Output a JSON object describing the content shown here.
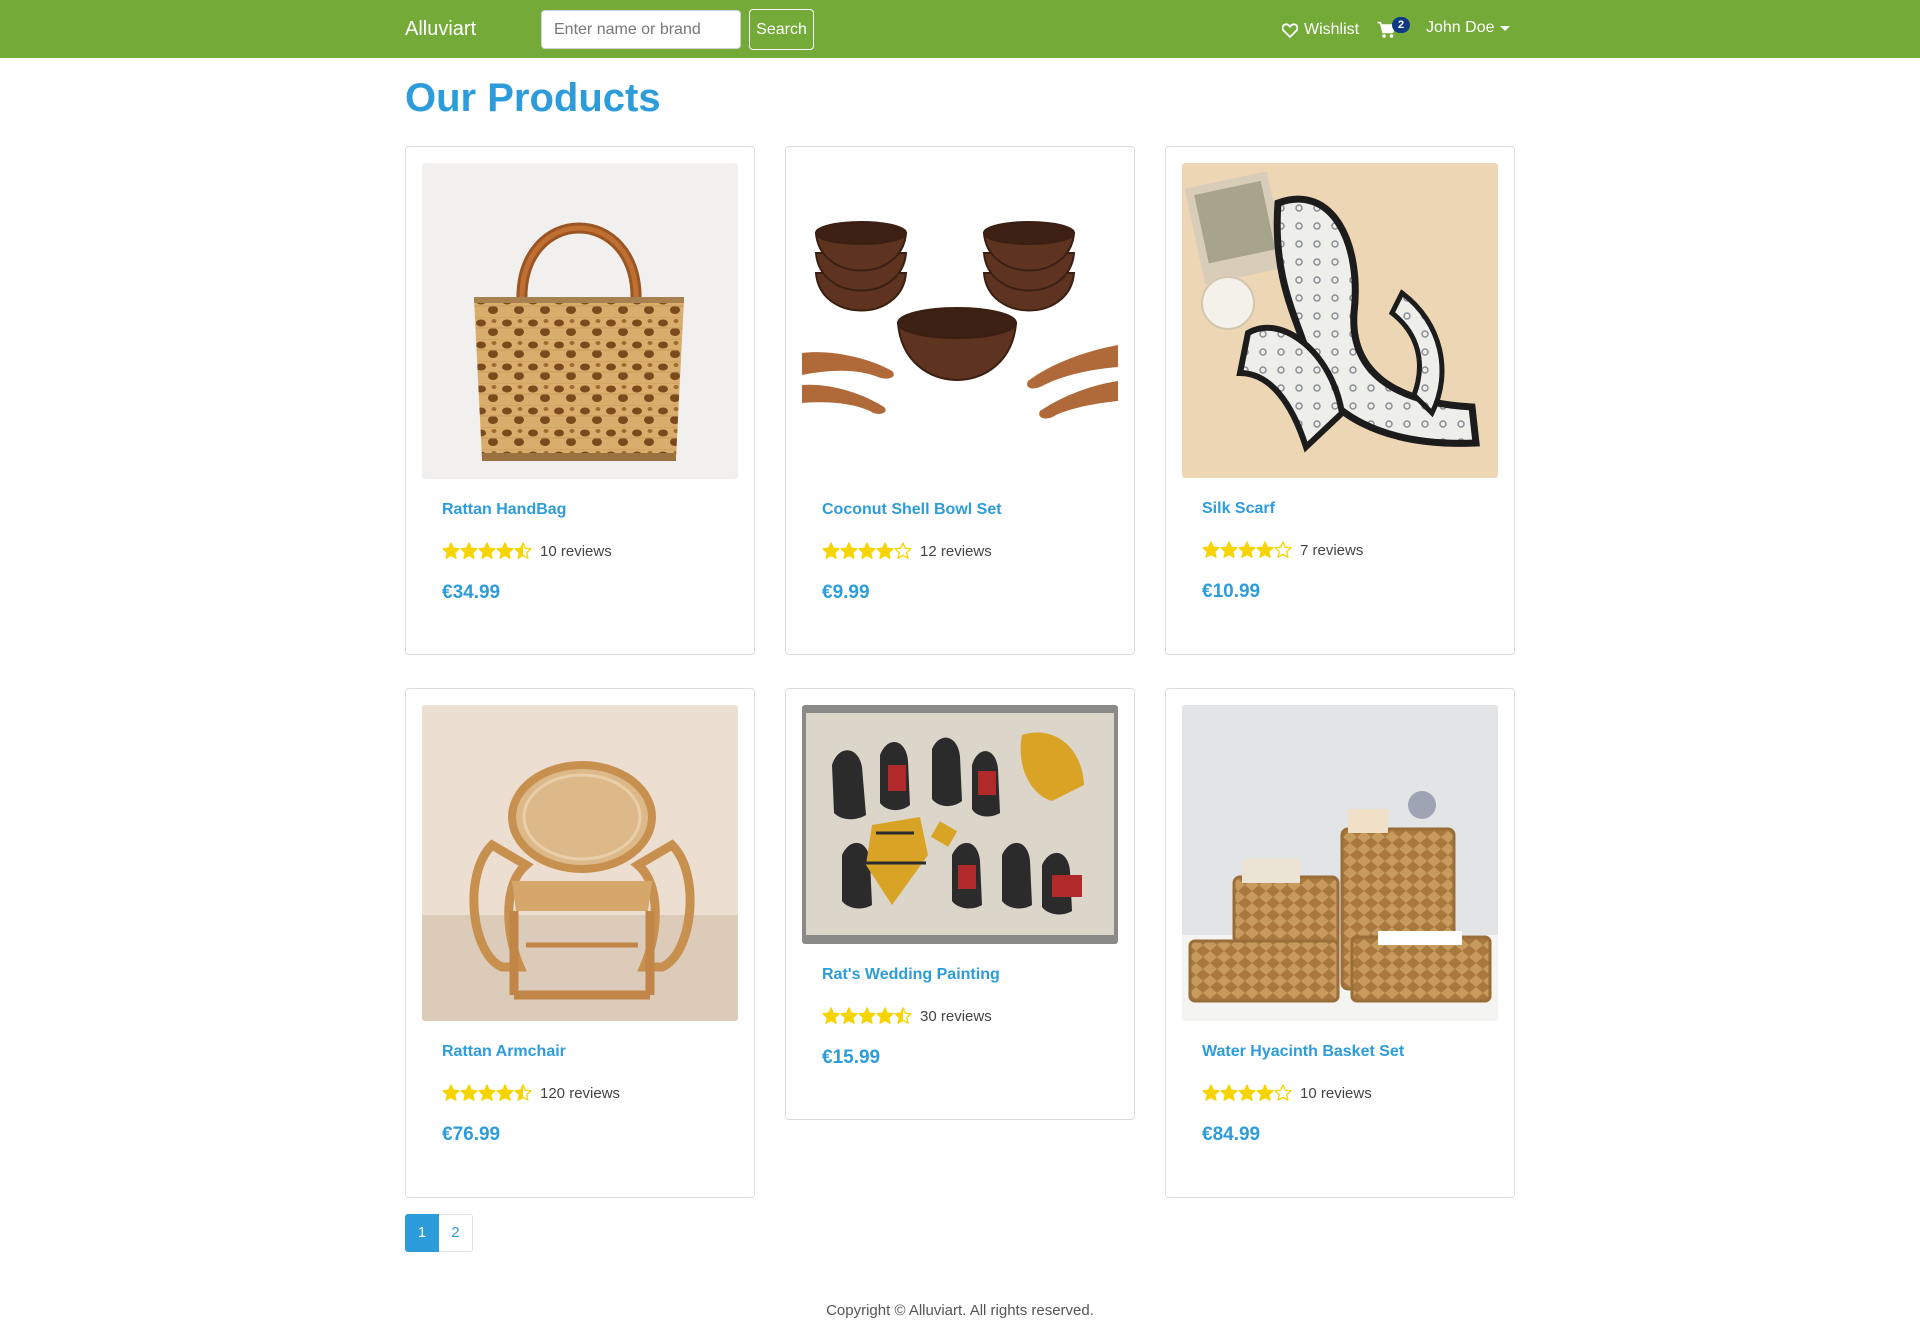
{
  "navbar": {
    "brand": "Alluviart",
    "search_placeholder": "Enter name or brand",
    "search_button": "Search",
    "wishlist_label": "Wishlist",
    "cart_count": "2",
    "user_name": "John Doe",
    "background_color": "#73aa38"
  },
  "page": {
    "title": "Our Products"
  },
  "products": [
    {
      "name": "Rattan HandBag",
      "rating": 4.5,
      "reviews": "10 reviews",
      "price": "€34.99",
      "image": "rattan-handbag"
    },
    {
      "name": "Coconut Shell Bowl Set",
      "rating": 4,
      "reviews": "12 reviews",
      "price": "€9.99",
      "image": "coconut-bowls"
    },
    {
      "name": "Silk Scarf",
      "rating": 4,
      "reviews": "7 reviews",
      "price": "€10.99",
      "image": "silk-scarf"
    },
    {
      "name": "Rattan Armchair",
      "rating": 4.5,
      "reviews": "120 reviews",
      "price": "€76.99",
      "image": "rattan-armchair"
    },
    {
      "name": "Rat's Wedding Painting",
      "rating": 4.5,
      "reviews": "30 reviews",
      "price": "€15.99",
      "image": "rats-wedding-painting"
    },
    {
      "name": "Water Hyacinth Basket Set",
      "rating": 4,
      "reviews": "10 reviews",
      "price": "€84.99",
      "image": "hyacinth-baskets"
    }
  ],
  "pagination": {
    "pages": [
      "1",
      "2"
    ],
    "current": "1"
  },
  "footer": {
    "copyright": "Copyright © Alluviart. All rights reserved."
  },
  "colors": {
    "accent": "#2d9cdb",
    "star": "#f5d400",
    "badge": "#103a86"
  }
}
